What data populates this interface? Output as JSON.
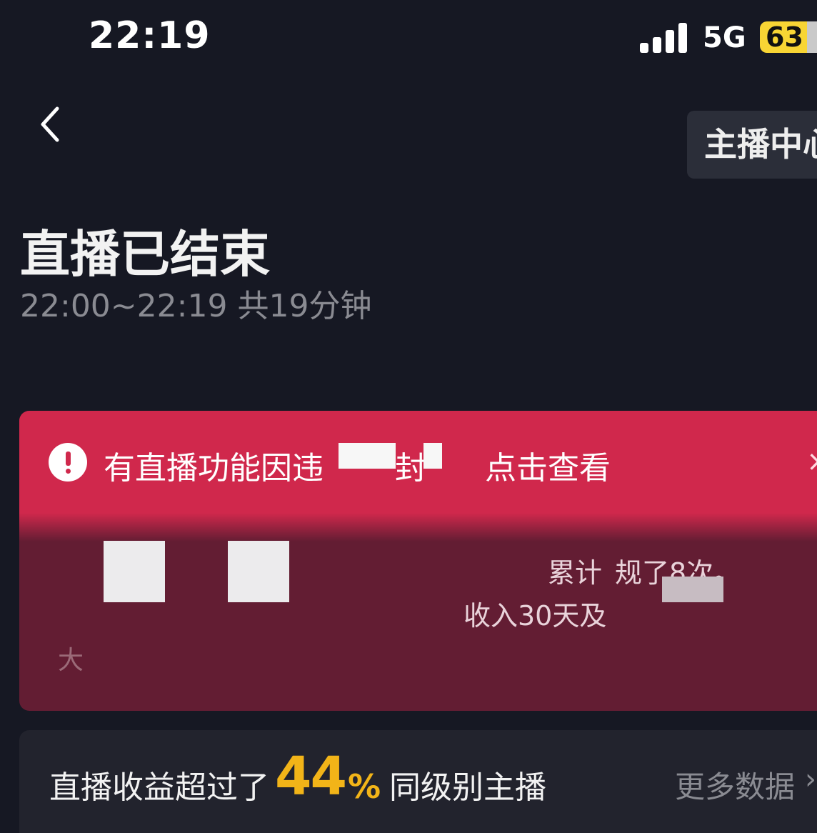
{
  "status_bar": {
    "time": "22:19",
    "network": "5G",
    "battery": "63"
  },
  "nav": {
    "anchor_center_label": "主播中心"
  },
  "header": {
    "title": "直播已结束",
    "subtitle": "22:00~22:19 共19分钟"
  },
  "violation_card": {
    "notice_part1": "有直播功能因违",
    "notice_part2": "封",
    "link_label": "点击查看",
    "close_glyph": "×",
    "detail_text1": "累计",
    "detail_text2": "规了8次。",
    "detail_text3": "收入30天及",
    "detail_text4": "大"
  },
  "revenue": {
    "prefix": "直播收益超过了",
    "percent": "44",
    "percent_sign": "%",
    "suffix": "同级别主播",
    "more_label": "更多数据",
    "more_arrow": "›"
  },
  "colors": {
    "background": "#161823",
    "alert": "#d0284c",
    "highlight": "#f2b418"
  }
}
